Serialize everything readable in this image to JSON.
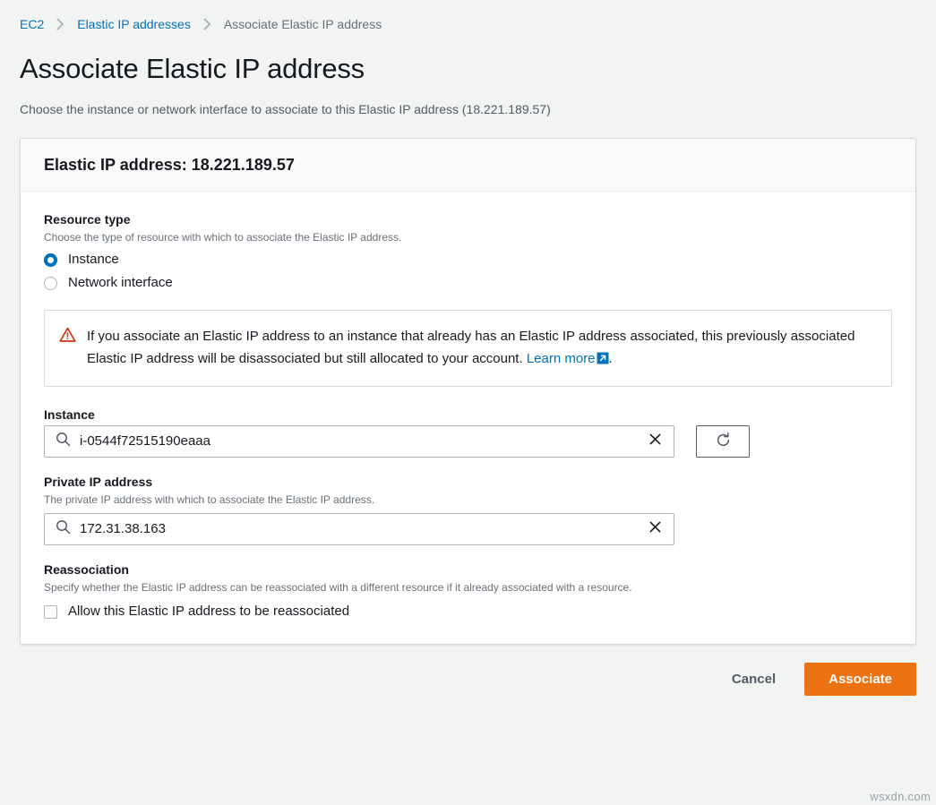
{
  "breadcrumb": {
    "items": [
      {
        "label": "EC2",
        "type": "link"
      },
      {
        "label": "Elastic IP addresses",
        "type": "link"
      },
      {
        "label": "Associate Elastic IP address",
        "type": "current"
      }
    ],
    "separator_icon": "chevron-right-icon"
  },
  "header": {
    "title": "Associate Elastic IP address",
    "description": "Choose the instance or network interface to associate to this Elastic IP address (18.221.189.57)"
  },
  "card": {
    "heading": "Elastic IP address: 18.221.189.57"
  },
  "resource_type": {
    "label": "Resource type",
    "hint": "Choose the type of resource with which to associate the Elastic IP address.",
    "options": [
      {
        "label": "Instance",
        "selected": true
      },
      {
        "label": "Network interface",
        "selected": false
      }
    ]
  },
  "alert": {
    "icon": "warning-triangle-icon",
    "text": "If you associate an Elastic IP address to an instance that already has an Elastic IP address associated, this previously associated Elastic IP address will be disassociated but still allocated to your account. ",
    "link_label": "Learn more",
    "link_icon": "external-link-icon",
    "trailing_text": "."
  },
  "instance": {
    "label": "Instance",
    "value": "i-0544f72515190eaaa",
    "placeholder": "",
    "search_icon": "search-icon",
    "clear_icon": "close-icon",
    "refresh_icon": "refresh-icon"
  },
  "private_ip": {
    "label": "Private IP address",
    "hint": "The private IP address with which to associate the Elastic IP address.",
    "value": "172.31.38.163",
    "placeholder": "",
    "search_icon": "search-icon",
    "clear_icon": "close-icon"
  },
  "reassociation": {
    "label": "Reassociation",
    "hint": "Specify whether the Elastic IP address can be reassociated with a different resource if it already associated with a resource.",
    "checkbox_label": "Allow this Elastic IP address to be reassociated",
    "checked": false
  },
  "footer": {
    "cancel_label": "Cancel",
    "associate_label": "Associate"
  },
  "watermark": "wsxdn.com",
  "colors": {
    "page_background": "#f2f3f3",
    "link": "#0073bb",
    "primary_button": "#ec7211",
    "warning": "#d13212",
    "text": "#16191f",
    "muted_text": "#687078"
  }
}
